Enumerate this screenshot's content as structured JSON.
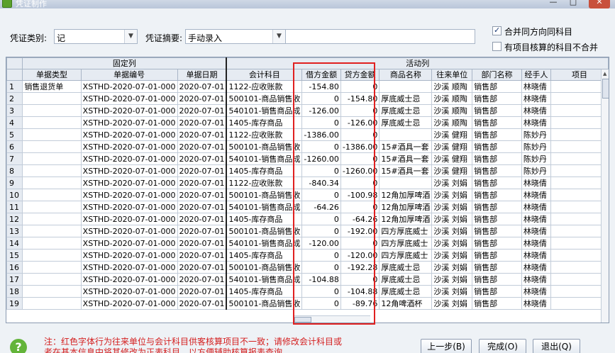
{
  "window": {
    "title": "凭证制作",
    "minimize": "—",
    "maximize": "□",
    "close": "✕"
  },
  "form": {
    "voucher_type_label": "凭证类别:",
    "voucher_type_value": "记",
    "summary_label": "凭证摘要:",
    "summary_value": "手动录入",
    "merge_same_direction_label": "合并同方向同科目",
    "merge_same_direction_checked": true,
    "no_merge_project_label": "有项目核算的科目不合并",
    "no_merge_project_checked": false
  },
  "grid": {
    "group_fixed": "固定列",
    "group_active": "活动列",
    "columns": [
      "单据类型",
      "单据编号",
      "单据日期",
      "会计科目",
      "借方金额",
      "贷方金额",
      "商品名称",
      "往来单位",
      "部门名称",
      "经手人",
      "项目"
    ],
    "rows": [
      {
        "n": "1",
        "type": "销售退货单",
        "no": "XSTHD-2020-07-01-000",
        "date": "2020-07-01",
        "acct": "1122-应收账款",
        "debit": "-154.80",
        "credit": "0",
        "goods": "",
        "unit": "沙溪  顺陶",
        "dept": "销售部",
        "person": "林晓倩"
      },
      {
        "n": "2",
        "type": "",
        "no": "XSTHD-2020-07-01-000",
        "date": "2020-07-01",
        "acct": "500101-商品销售收",
        "debit": "0",
        "credit": "-154.80",
        "goods": "厚底威士忌",
        "unit": "沙溪  顺陶",
        "dept": "销售部",
        "person": "林晓倩"
      },
      {
        "n": "3",
        "type": "",
        "no": "XSTHD-2020-07-01-000",
        "date": "2020-07-01",
        "acct": "540101-销售商品成",
        "debit": "-126.00",
        "credit": "0",
        "goods": "厚底威士忌",
        "unit": "沙溪  顺陶",
        "dept": "销售部",
        "person": "林晓倩"
      },
      {
        "n": "4",
        "type": "",
        "no": "XSTHD-2020-07-01-000",
        "date": "2020-07-01",
        "acct": "1405-库存商品",
        "debit": "0",
        "credit": "-126.00",
        "goods": "厚底威士忌",
        "unit": "沙溪  顺陶",
        "dept": "销售部",
        "person": "林晓倩"
      },
      {
        "n": "5",
        "type": "",
        "no": "XSTHD-2020-07-01-000",
        "date": "2020-07-01",
        "acct": "1122-应收账款",
        "debit": "-1386.00",
        "credit": "0",
        "goods": "",
        "unit": "沙溪  健翔",
        "dept": "销售部",
        "person": "陈妙丹"
      },
      {
        "n": "6",
        "type": "",
        "no": "XSTHD-2020-07-01-000",
        "date": "2020-07-01",
        "acct": "500101-商品销售收",
        "debit": "0",
        "credit": "-1386.00",
        "goods": "15#酒具一套",
        "unit": "沙溪  健翔",
        "dept": "销售部",
        "person": "陈妙丹"
      },
      {
        "n": "7",
        "type": "",
        "no": "XSTHD-2020-07-01-000",
        "date": "2020-07-01",
        "acct": "540101-销售商品成",
        "debit": "-1260.00",
        "credit": "0",
        "goods": "15#酒具一套",
        "unit": "沙溪  健翔",
        "dept": "销售部",
        "person": "陈妙丹"
      },
      {
        "n": "8",
        "type": "",
        "no": "XSTHD-2020-07-01-000",
        "date": "2020-07-01",
        "acct": "1405-库存商品",
        "debit": "0",
        "credit": "-1260.00",
        "goods": "15#酒具一套",
        "unit": "沙溪  健翔",
        "dept": "销售部",
        "person": "陈妙丹"
      },
      {
        "n": "9",
        "type": "",
        "no": "XSTHD-2020-07-01-000",
        "date": "2020-07-01",
        "acct": "1122-应收账款",
        "debit": "-840.34",
        "credit": "0",
        "goods": "",
        "unit": "沙溪  刘娟",
        "dept": "销售部",
        "person": "林晓倩"
      },
      {
        "n": "10",
        "type": "",
        "no": "XSTHD-2020-07-01-000",
        "date": "2020-07-01",
        "acct": "500101-商品销售收",
        "debit": "0",
        "credit": "-100.98",
        "goods": "12角加厚啤酒",
        "unit": "沙溪  刘娟",
        "dept": "销售部",
        "person": "林晓倩"
      },
      {
        "n": "11",
        "type": "",
        "no": "XSTHD-2020-07-01-000",
        "date": "2020-07-01",
        "acct": "540101-销售商品成",
        "debit": "-64.26",
        "credit": "0",
        "goods": "12角加厚啤酒",
        "unit": "沙溪  刘娟",
        "dept": "销售部",
        "person": "林晓倩"
      },
      {
        "n": "12",
        "type": "",
        "no": "XSTHD-2020-07-01-000",
        "date": "2020-07-01",
        "acct": "1405-库存商品",
        "debit": "0",
        "credit": "-64.26",
        "goods": "12角加厚啤酒",
        "unit": "沙溪  刘娟",
        "dept": "销售部",
        "person": "林晓倩"
      },
      {
        "n": "13",
        "type": "",
        "no": "XSTHD-2020-07-01-000",
        "date": "2020-07-01",
        "acct": "500101-商品销售收",
        "debit": "0",
        "credit": "-192.00",
        "goods": "四方厚底威士",
        "unit": "沙溪  刘娟",
        "dept": "销售部",
        "person": "林晓倩"
      },
      {
        "n": "14",
        "type": "",
        "no": "XSTHD-2020-07-01-000",
        "date": "2020-07-01",
        "acct": "540101-销售商品成",
        "debit": "-120.00",
        "credit": "0",
        "goods": "四方厚底威士",
        "unit": "沙溪  刘娟",
        "dept": "销售部",
        "person": "林晓倩"
      },
      {
        "n": "15",
        "type": "",
        "no": "XSTHD-2020-07-01-000",
        "date": "2020-07-01",
        "acct": "1405-库存商品",
        "debit": "0",
        "credit": "-120.00",
        "goods": "四方厚底威士",
        "unit": "沙溪  刘娟",
        "dept": "销售部",
        "person": "林晓倩"
      },
      {
        "n": "16",
        "type": "",
        "no": "XSTHD-2020-07-01-000",
        "date": "2020-07-01",
        "acct": "500101-商品销售收",
        "debit": "0",
        "credit": "-192.28",
        "goods": "厚底威士忌",
        "unit": "沙溪  刘娟",
        "dept": "销售部",
        "person": "林晓倩"
      },
      {
        "n": "17",
        "type": "",
        "no": "XSTHD-2020-07-01-000",
        "date": "2020-07-01",
        "acct": "540101-销售商品成",
        "debit": "-104.88",
        "credit": "0",
        "goods": "厚底威士忌",
        "unit": "沙溪  刘娟",
        "dept": "销售部",
        "person": "林晓倩"
      },
      {
        "n": "18",
        "type": "",
        "no": "XSTHD-2020-07-01-000",
        "date": "2020-07-01",
        "acct": "1405-库存商品",
        "debit": "0",
        "credit": "-104.88",
        "goods": "厚底威士忌",
        "unit": "沙溪  刘娟",
        "dept": "销售部",
        "person": "林晓倩"
      },
      {
        "n": "19",
        "type": "",
        "no": "XSTHD-2020-07-01-000",
        "date": "2020-07-01",
        "acct": "500101-商品销售收",
        "debit": "0",
        "credit": "-89.76",
        "goods": "12角啤酒杯",
        "unit": "沙溪  刘娟",
        "dept": "销售部",
        "person": "林晓倩"
      }
    ]
  },
  "footer": {
    "help": "?",
    "notice": "注：红色字体行为往来单位与会计科目供客核算项目不一致；请修改会计科目或者在基本信息中将其修改为正表科目，以方便辅助核算报表查询。",
    "prev_label": "上一步(B)",
    "finish_label": "完成(O)",
    "exit_label": "退出(Q)"
  },
  "colors": {
    "highlight_box": "#e02020",
    "notice_text": "#d41f1f"
  }
}
